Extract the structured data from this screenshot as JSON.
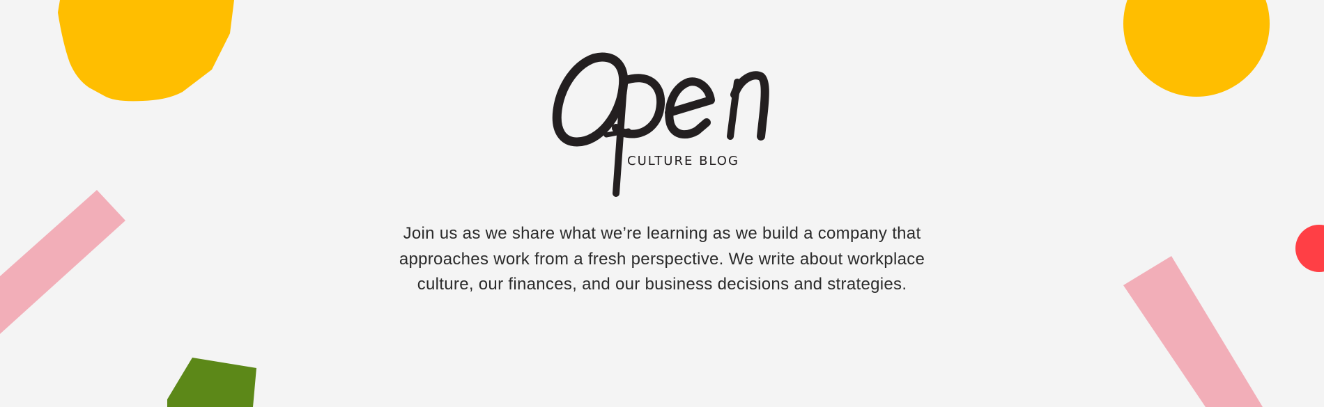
{
  "brand": {
    "logo_word": "Open",
    "subtitle": "CULTURE BLOG"
  },
  "intro": {
    "text": "Join us as we share what we’re learning as we build a company that approaches work from a fresh perspective. We write about workplace culture, our finances, and our business decisions and strategies."
  },
  "colors": {
    "background": "#f4f4f4",
    "yellow": "#ffbe00",
    "pink": "#f2aeb8",
    "green": "#5c8818",
    "red": "#ff3f45",
    "ink": "#231f20"
  },
  "decorations": [
    "yellow-blob-shape",
    "yellow-circle-shape",
    "pink-bar-left-shape",
    "pink-bar-right-shape",
    "green-quad-shape",
    "red-half-circle-shape"
  ]
}
